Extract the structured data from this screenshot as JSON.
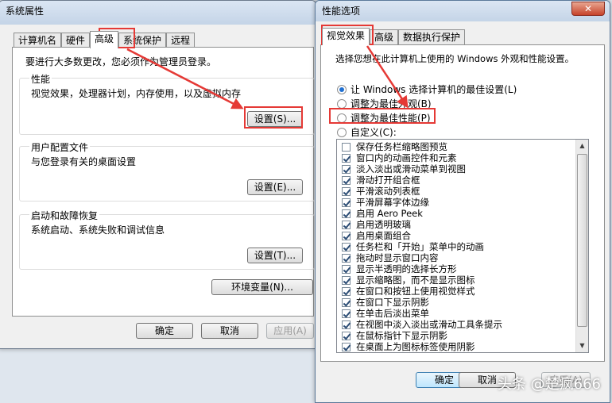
{
  "sysprops": {
    "title": "系统属性",
    "tabs": [
      "计算机名",
      "硬件",
      "高级",
      "系统保护",
      "远程"
    ],
    "admin_note": "要进行大多数更改，您必须作为管理员登录。",
    "perf": {
      "title": "性能",
      "desc": "视觉效果，处理器计划，内存使用，以及虚拟内存",
      "button": "设置(S)..."
    },
    "profile": {
      "title": "用户配置文件",
      "desc": "与您登录有关的桌面设置",
      "button": "设置(E)..."
    },
    "startup": {
      "title": "启动和故障恢复",
      "desc": "系统启动、系统失败和调试信息",
      "button": "设置(T)..."
    },
    "env_button": "环境变量(N)...",
    "ok": "确定",
    "cancel": "取消",
    "apply": "应用(A)"
  },
  "perfopts": {
    "title": "性能选项",
    "close_glyph": "✕",
    "tabs": [
      "视觉效果",
      "高级",
      "数据执行保护"
    ],
    "instruction": "选择您想在此计算机上使用的 Windows 外观和性能设置。",
    "radios": [
      {
        "label": "让 Windows 选择计算机的最佳设置(L)",
        "checked": true
      },
      {
        "label": "调整为最佳外观(B)",
        "checked": false
      },
      {
        "label": "调整为最佳性能(P)",
        "checked": false
      },
      {
        "label": "自定义(C):",
        "checked": false
      }
    ],
    "effects": [
      {
        "label": "保存任务栏缩略图预览",
        "checked": false
      },
      {
        "label": "窗口内的动画控件和元素",
        "checked": true
      },
      {
        "label": "淡入淡出或滑动菜单到视图",
        "checked": true
      },
      {
        "label": "滑动打开组合框",
        "checked": true
      },
      {
        "label": "平滑滚动列表框",
        "checked": true
      },
      {
        "label": "平滑屏幕字体边缘",
        "checked": true
      },
      {
        "label": "启用 Aero Peek",
        "checked": true
      },
      {
        "label": "启用透明玻璃",
        "checked": true
      },
      {
        "label": "启用桌面组合",
        "checked": true
      },
      {
        "label": "任务栏和「开始」菜单中的动画",
        "checked": true
      },
      {
        "label": "拖动时显示窗口内容",
        "checked": true
      },
      {
        "label": "显示半透明的选择长方形",
        "checked": true
      },
      {
        "label": "显示缩略图，而不是显示图标",
        "checked": true
      },
      {
        "label": "在窗口和按钮上使用视觉样式",
        "checked": true
      },
      {
        "label": "在窗口下显示阴影",
        "checked": true
      },
      {
        "label": "在单击后淡出菜单",
        "checked": true
      },
      {
        "label": "在视图中淡入淡出或滑动工具条提示",
        "checked": true
      },
      {
        "label": "在鼠标指针下显示阴影",
        "checked": true
      },
      {
        "label": "在桌面上为图标标签使用阴影",
        "checked": true
      }
    ],
    "ok": "确定",
    "cancel": "取消",
    "apply": "应用(A)"
  },
  "watermark": "头条 @楚疯666",
  "colors": {
    "annotation_red": "#e53935",
    "accent": "#1f6fd1"
  }
}
